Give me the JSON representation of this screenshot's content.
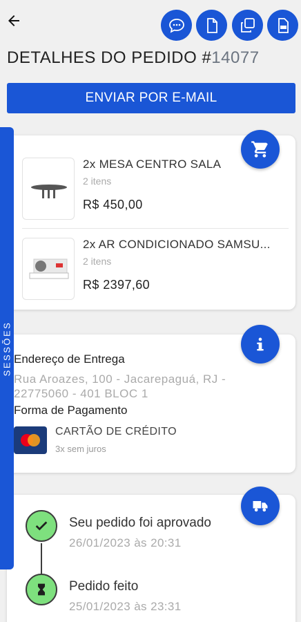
{
  "header": {
    "title_prefix": "DETALHES DO PEDIDO #",
    "order_number": "14077",
    "email_button": "ENVIAR POR E-MAIL"
  },
  "items": [
    {
      "name": "2x MESA CENTRO SALA",
      "qty": "2 itens",
      "price": "R$ 450,00"
    },
    {
      "name": "2x AR CONDICIONADO SAMSU...",
      "qty": "2 itens",
      "price": "R$ 2397,60"
    }
  ],
  "info": {
    "delivery_label": "Endereço de Entrega",
    "address": "Rua  Aroazes, 100 - Jacarepaguá, RJ - 22775060 - 401 BLOC 1",
    "payment_label": "Forma de Pagamento",
    "payment_method": "CARTÃO DE CRÉDITO",
    "installments": "3x sem juros"
  },
  "status": [
    {
      "title": "Seu pedido foi aprovado",
      "time": "26/01/2023 às 20:31",
      "icon": "check-icon"
    },
    {
      "title": "Pedido feito",
      "time": "25/01/2023 às 23:31",
      "icon": "hourglass-icon"
    }
  ],
  "sidebar": {
    "label": "SESSÕES"
  },
  "icons": {
    "back": "arrow-left-icon",
    "chat": "chat-bubble-icon",
    "document": "document-icon",
    "copy": "copy-icon",
    "pdf": "pdf-icon",
    "cart": "cart-icon",
    "info": "info-icon",
    "delivery": "delivery-truck-icon"
  },
  "colors": {
    "primary": "#1a56d6",
    "success": "#7ee07e"
  }
}
